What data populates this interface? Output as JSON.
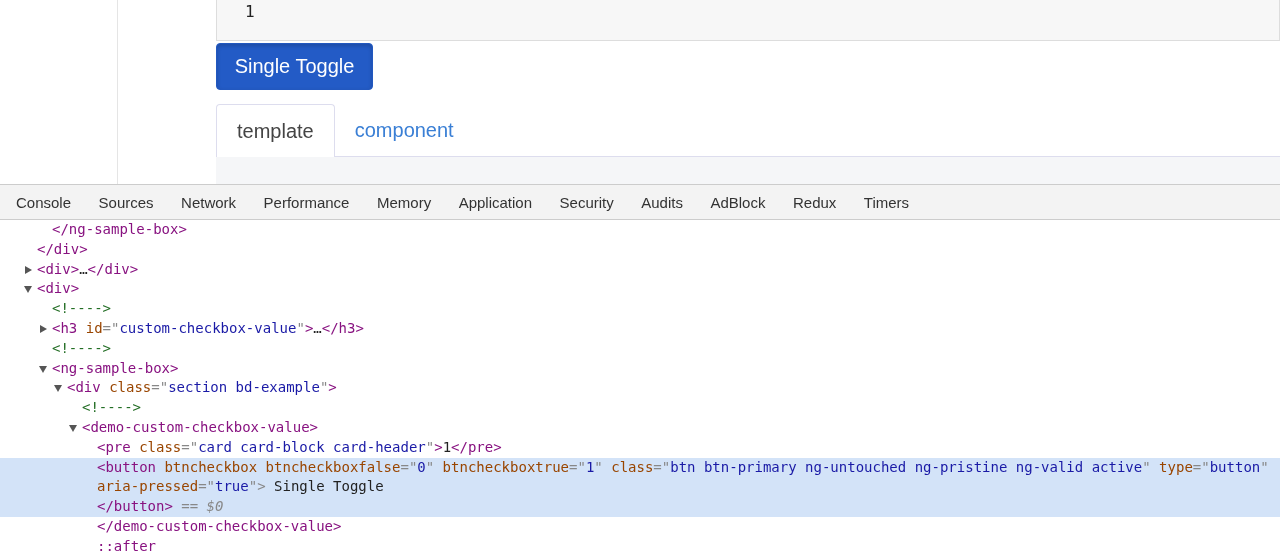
{
  "page": {
    "output": "1",
    "toggle_button": {
      "label": "Single Toggle",
      "active": true
    },
    "tabs": [
      {
        "label": "template",
        "selected": true
      },
      {
        "label": "component",
        "selected": false
      }
    ]
  },
  "devtools": {
    "tabs": [
      {
        "label": "Console",
        "selected": false
      },
      {
        "label": "Sources",
        "selected": false
      },
      {
        "label": "Network",
        "selected": false
      },
      {
        "label": "Performance",
        "selected": false
      },
      {
        "label": "Memory",
        "selected": false
      },
      {
        "label": "Application",
        "selected": false
      },
      {
        "label": "Security",
        "selected": false
      },
      {
        "label": "Audits",
        "selected": false
      },
      {
        "label": "AdBlock",
        "selected": false
      },
      {
        "label": "Redux",
        "selected": false
      },
      {
        "label": "Timers",
        "selected": false
      }
    ],
    "tree": [
      {
        "children": [
          {
            "tokens": [
              {
                "kind": "tag",
                "text": "</ng-sample-box>"
              }
            ]
          }
        ]
      },
      {
        "tokens": [
          {
            "kind": "tag",
            "text": "</div>"
          }
        ]
      },
      {
        "tokens": [
          {
            "kind": "tag",
            "text": "<div>"
          },
          {
            "kind": "text",
            "text": "…"
          },
          {
            "kind": "tag",
            "text": "</div>"
          }
        ],
        "expanded": false
      },
      {
        "tokens": [
          {
            "kind": "tag",
            "text": "<div>"
          }
        ],
        "expanded": true,
        "children": [
          {
            "tokens": [
              {
                "kind": "comment",
                "text": "<!---->"
              }
            ]
          },
          {
            "tokens": [
              {
                "kind": "tag",
                "text": "<h3 "
              },
              {
                "kind": "attr",
                "text": "id"
              },
              {
                "kind": "punct",
                "text": "=\""
              },
              {
                "kind": "value",
                "text": "custom-checkbox-value"
              },
              {
                "kind": "punct",
                "text": "\""
              },
              {
                "kind": "tag",
                "text": ">"
              },
              {
                "kind": "text",
                "text": "…"
              },
              {
                "kind": "tag",
                "text": "</h3>"
              }
            ],
            "expanded": false
          },
          {
            "tokens": [
              {
                "kind": "comment",
                "text": "<!---->"
              }
            ]
          },
          {
            "tokens": [
              {
                "kind": "tag",
                "text": "<ng-sample-box>"
              }
            ],
            "expanded": true,
            "children": [
              {
                "tokens": [
                  {
                    "kind": "tag",
                    "text": "<div "
                  },
                  {
                    "kind": "attr",
                    "text": "class"
                  },
                  {
                    "kind": "punct",
                    "text": "=\""
                  },
                  {
                    "kind": "value",
                    "text": "section bd-example"
                  },
                  {
                    "kind": "punct",
                    "text": "\""
                  },
                  {
                    "kind": "tag",
                    "text": ">"
                  }
                ],
                "expanded": true,
                "children": [
                  {
                    "tokens": [
                      {
                        "kind": "comment",
                        "text": "<!---->"
                      }
                    ]
                  },
                  {
                    "tokens": [
                      {
                        "kind": "tag",
                        "text": "<demo-custom-checkbox-value>"
                      }
                    ],
                    "expanded": true,
                    "children": [
                      {
                        "tokens": [
                          {
                            "kind": "tag",
                            "text": "<pre "
                          },
                          {
                            "kind": "attr",
                            "text": "class"
                          },
                          {
                            "kind": "punct",
                            "text": "=\""
                          },
                          {
                            "kind": "value",
                            "text": "card card-block card-header"
                          },
                          {
                            "kind": "punct",
                            "text": "\""
                          },
                          {
                            "kind": "tag",
                            "text": ">"
                          },
                          {
                            "kind": "text",
                            "text": "1"
                          },
                          {
                            "kind": "tag",
                            "text": "</pre>"
                          }
                        ]
                      },
                      {
                        "tokens": [
                          {
                            "kind": "tag",
                            "text": "<button "
                          },
                          {
                            "kind": "attr",
                            "text": "btncheckbox "
                          },
                          {
                            "kind": "attr",
                            "text": "btncheckboxfalse"
                          },
                          {
                            "kind": "punct",
                            "text": "=\""
                          },
                          {
                            "kind": "value",
                            "text": "0"
                          },
                          {
                            "kind": "punct",
                            "text": "\" "
                          },
                          {
                            "kind": "attr",
                            "text": "btncheckboxtrue"
                          },
                          {
                            "kind": "punct",
                            "text": "=\""
                          },
                          {
                            "kind": "value",
                            "text": "1"
                          },
                          {
                            "kind": "punct",
                            "text": "\" "
                          },
                          {
                            "kind": "attr",
                            "text": "class"
                          },
                          {
                            "kind": "punct",
                            "text": "=\""
                          },
                          {
                            "kind": "value",
                            "text": "btn btn-primary ng-untouched ng-pristine ng-valid active"
                          },
                          {
                            "kind": "punct",
                            "text": "\" "
                          },
                          {
                            "kind": "attr",
                            "text": "type"
                          },
                          {
                            "kind": "punct",
                            "text": "=\""
                          },
                          {
                            "kind": "value",
                            "text": "button"
                          },
                          {
                            "kind": "punct",
                            "text": "\" "
                          },
                          {
                            "kind": "attr",
                            "text": "aria-pressed"
                          },
                          {
                            "kind": "punct",
                            "text": "=\""
                          },
                          {
                            "kind": "value",
                            "text": "true"
                          },
                          {
                            "kind": "punct",
                            "text": "\">"
                          },
                          {
                            "kind": "text",
                            "text": " Single Toggle"
                          }
                        ],
                        "selected": true,
                        "close": [
                          {
                            "kind": "tag",
                            "text": "</button>"
                          },
                          {
                            "kind": "ref",
                            "text": " == $0"
                          }
                        ]
                      },
                      {
                        "tokens": [
                          {
                            "kind": "tag",
                            "text": "</demo-custom-checkbox-value>"
                          }
                        ]
                      },
                      {
                        "tokens": [
                          {
                            "kind": "pseudo",
                            "text": "::after"
                          }
                        ]
                      }
                    ]
                  }
                ]
              }
            ]
          }
        ]
      }
    ]
  }
}
